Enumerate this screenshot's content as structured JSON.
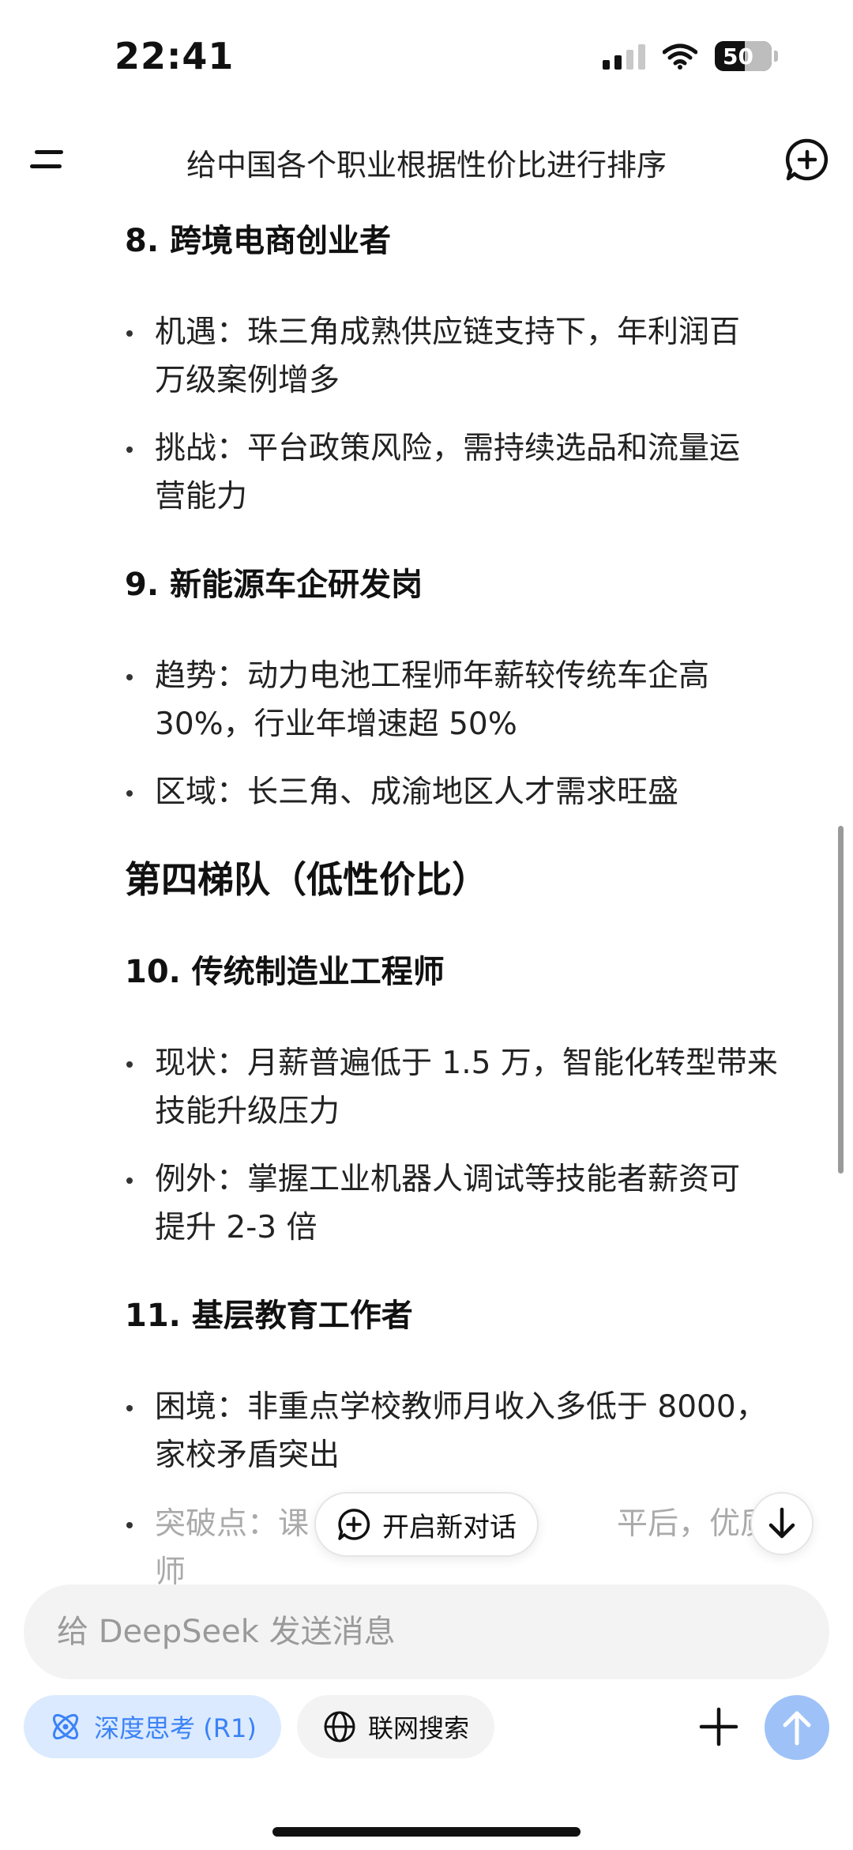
{
  "status_bar": {
    "time": "22:41",
    "battery": "50"
  },
  "header": {
    "title": "给中国各个职业根据性价比进行排序"
  },
  "content": {
    "section8": {
      "title": "8. 跨境电商创业者",
      "bullets": [
        [
          "机遇：珠三角成熟供应链支持下，年利润百",
          "万级案例增多"
        ],
        [
          "挑战：平台政策风险，需持续选品和流量运",
          "营能力"
        ]
      ]
    },
    "section9": {
      "title": "9. 新能源车企研发岗",
      "bullets": [
        [
          "趋势：动力电池工程师年薪较传统车企高",
          "30%，行业年增速超 50%"
        ],
        [
          "区域：长三角、成渝地区人才需求旺盛"
        ]
      ]
    },
    "tier4_title": "第四梯队（低性价比）",
    "section10": {
      "title": "10. 传统制造业工程师",
      "bullets": [
        [
          "现状：月薪普遍低于 1.5 万，智能化转型带来",
          "技能升级压力"
        ],
        [
          "例外：掌握工业机器人调试等技能者薪资可",
          "提升 2-3 倍"
        ]
      ]
    },
    "section11": {
      "title": "11. 基层教育工作者",
      "bullets": [
        [
          "困境：非重点学校教师月收入多低于 8000，",
          "家校矛盾突出"
        ],
        [
          "突破点：课",
          "平后，优质教师"
        ]
      ]
    }
  },
  "floating": {
    "new_dialog_label": "开启新对话"
  },
  "composer": {
    "placeholder": "给 DeepSeek 发送消息",
    "deep_think_label": "深度思考 (R1)",
    "web_search_label": "联网搜索"
  },
  "colors": {
    "accent_blue": "#3b82f6",
    "deep_think_bg": "#dbeafe",
    "send_button": "#9ec2f7",
    "input_bg": "#f3f3f3"
  },
  "icons": [
    "signal-icon",
    "wifi-icon",
    "battery-icon",
    "menu-icon",
    "new-chat-icon",
    "plus-circle-icon",
    "arrow-down-icon",
    "atom-icon",
    "globe-icon",
    "plus-icon",
    "arrow-up-icon"
  ]
}
